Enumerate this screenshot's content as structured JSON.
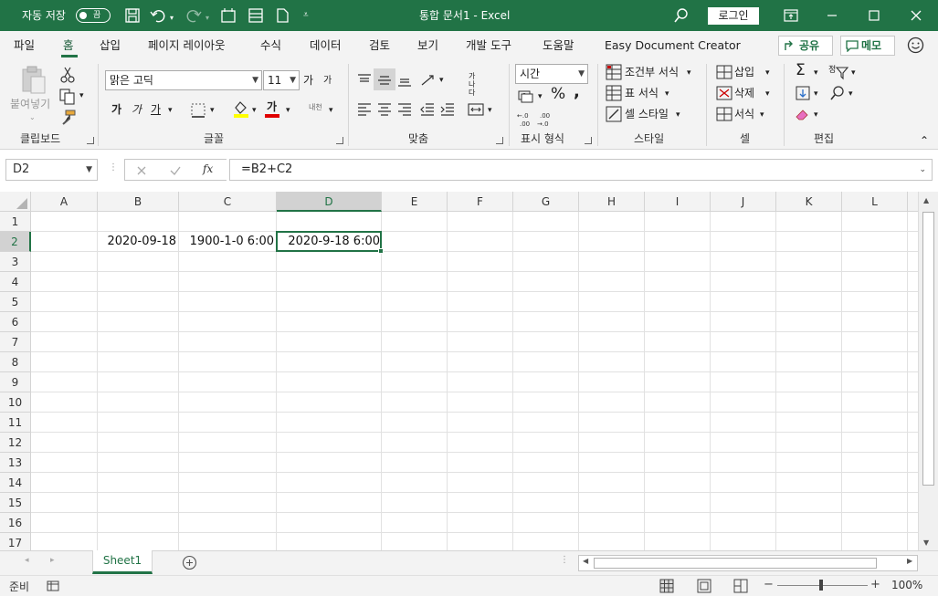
{
  "titlebar": {
    "autosave_label": "자동 저장",
    "autosave_state": "끔",
    "doc_title": "통합 문서1 - Excel",
    "login": "로그인"
  },
  "menu": {
    "tabs": [
      "파일",
      "홈",
      "삽입",
      "페이지 레이아웃",
      "수식",
      "데이터",
      "검토",
      "보기",
      "개발 도구",
      "도움말",
      "Easy Document Creator"
    ],
    "active": "홈",
    "share": "공유",
    "comments": "메모"
  },
  "ribbon": {
    "clipboard": {
      "label": "클립보드",
      "paste": "붙여넣기"
    },
    "font": {
      "label": "글꼴",
      "name": "맑은 고딕",
      "size": "11",
      "grow": "가",
      "shrink": "가",
      "bold": "가",
      "italic": "가",
      "underline": "가",
      "font_color": "가",
      "phonetic": "내천"
    },
    "alignment": {
      "label": "맞춤",
      "wrap": "가나다"
    },
    "number": {
      "label": "표시 형식",
      "format": "시간"
    },
    "styles": {
      "label": "스타일",
      "conditional": "조건부 서식",
      "table": "표 서식",
      "cell": "셀 스타일"
    },
    "cells": {
      "label": "셀",
      "insert": "삽입",
      "delete": "삭제",
      "format": "서식"
    },
    "editing": {
      "label": "편집",
      "sort": "정"
    }
  },
  "formula_bar": {
    "name_box": "D2",
    "formula": "=B2+C2"
  },
  "grid": {
    "columns": [
      "A",
      "B",
      "C",
      "D",
      "E",
      "F",
      "G",
      "H",
      "I",
      "J",
      "K",
      "L"
    ],
    "selected_column": "D",
    "rows": [
      "1",
      "2",
      "3",
      "4",
      "5",
      "6",
      "7",
      "8",
      "9",
      "10",
      "11",
      "12",
      "13",
      "14",
      "15",
      "16",
      "17"
    ],
    "selected_row": "2",
    "cells": {
      "B2": "2020-09-18",
      "C2": "1900-1-0 6:00",
      "D2": "2020-9-18 6:00"
    }
  },
  "sheets": {
    "tabs": [
      "Sheet1"
    ],
    "active": "Sheet1"
  },
  "status": {
    "mode": "준비",
    "zoom": "100%"
  },
  "colors": {
    "accent": "#217346"
  }
}
